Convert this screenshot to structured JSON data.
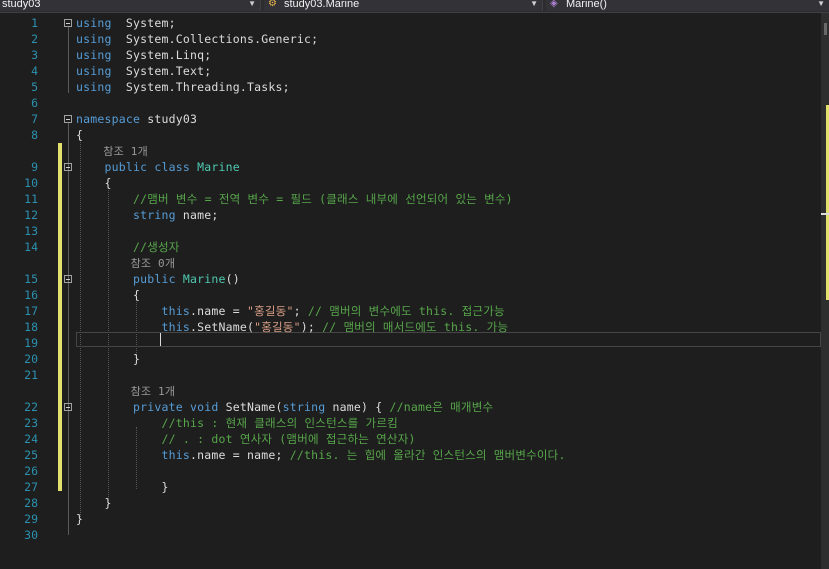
{
  "navbar": {
    "project": "study03",
    "class": "study03.Marine",
    "member": "Marine()",
    "class_icon": "class-icon",
    "member_icon": "method-icon"
  },
  "editor": {
    "lines": [
      {
        "n": "1",
        "t": [
          [
            "kw",
            "using"
          ],
          [
            "",
            "  System;"
          ]
        ]
      },
      {
        "n": "2",
        "t": [
          [
            "kw",
            "using"
          ],
          [
            "",
            "  System.Collections.Generic;"
          ]
        ]
      },
      {
        "n": "3",
        "t": [
          [
            "kw",
            "using"
          ],
          [
            "",
            "  System.Linq;"
          ]
        ]
      },
      {
        "n": "4",
        "t": [
          [
            "kw",
            "using"
          ],
          [
            "",
            "  System.Text;"
          ]
        ]
      },
      {
        "n": "5",
        "t": [
          [
            "kw",
            "using"
          ],
          [
            "",
            "  System.Threading.Tasks;"
          ]
        ]
      },
      {
        "n": "6",
        "t": []
      },
      {
        "n": "7",
        "t": [
          [
            "kw",
            "namespace"
          ],
          [
            "",
            " study03"
          ]
        ]
      },
      {
        "n": "8",
        "t": [
          [
            "",
            "{"
          ]
        ]
      },
      {
        "n": "",
        "t": [
          [
            "codelens",
            "    참조 1개"
          ]
        ]
      },
      {
        "n": "9",
        "t": [
          [
            "kw",
            "    public class "
          ],
          [
            "ty",
            "Marine"
          ]
        ]
      },
      {
        "n": "10",
        "t": [
          [
            "",
            "    {"
          ]
        ]
      },
      {
        "n": "11",
        "t": [
          [
            "cm",
            "        //맴버 변수 = 전역 변수 = 필드 (클래스 내부에 선언되어 있는 변수)"
          ]
        ]
      },
      {
        "n": "12",
        "t": [
          [
            "kw",
            "        string"
          ],
          [
            "",
            " name;"
          ]
        ]
      },
      {
        "n": "13",
        "t": []
      },
      {
        "n": "14",
        "t": [
          [
            "cm",
            "        //생성자"
          ]
        ]
      },
      {
        "n": "",
        "t": [
          [
            "codelens",
            "        참조 0개"
          ]
        ]
      },
      {
        "n": "15",
        "t": [
          [
            "kw",
            "        public "
          ],
          [
            "ty",
            "Marine"
          ],
          [
            "",
            "()"
          ]
        ]
      },
      {
        "n": "16",
        "t": [
          [
            "",
            "        {"
          ]
        ]
      },
      {
        "n": "17",
        "t": [
          [
            "kw",
            "            this"
          ],
          [
            "",
            ".name = "
          ],
          [
            "str",
            "\"홍길동\""
          ],
          [
            "",
            "; "
          ],
          [
            "cm",
            "// 맴버의 변수에도 this. 접근가능"
          ]
        ]
      },
      {
        "n": "18",
        "t": [
          [
            "kw",
            "            this"
          ],
          [
            "",
            ".SetName("
          ],
          [
            "str",
            "\"홍길동\""
          ],
          [
            "",
            "); "
          ],
          [
            "cm",
            "// 맴버의 매서드에도 this. 가능"
          ]
        ]
      },
      {
        "n": "19",
        "t": []
      },
      {
        "n": "20",
        "t": [
          [
            "",
            "        }"
          ]
        ]
      },
      {
        "n": "21",
        "t": []
      },
      {
        "n": "",
        "t": [
          [
            "codelens",
            "        참조 1개"
          ]
        ]
      },
      {
        "n": "22",
        "t": [
          [
            "kw",
            "        private void "
          ],
          [
            "",
            "SetName("
          ],
          [
            "kw",
            "string"
          ],
          [
            "",
            " name) { "
          ],
          [
            "cm",
            "//name은 매개변수"
          ]
        ]
      },
      {
        "n": "23",
        "t": [
          [
            "cm",
            "            //this : 현재 클래스의 인스턴스를 가르킴"
          ]
        ]
      },
      {
        "n": "24",
        "t": [
          [
            "cm",
            "            // . : dot 연사자 (맴버에 접근하는 연산자)"
          ]
        ]
      },
      {
        "n": "25",
        "t": [
          [
            "kw",
            "            this"
          ],
          [
            "",
            ".name = name; "
          ],
          [
            "cm",
            "//this. 는 힙에 올라간 인스턴스의 맴버변수이다."
          ]
        ]
      },
      {
        "n": "26",
        "t": []
      },
      {
        "n": "27",
        "t": [
          [
            "",
            "            }"
          ]
        ]
      },
      {
        "n": "28",
        "t": [
          [
            "",
            "    }"
          ]
        ]
      },
      {
        "n": "29",
        "t": [
          [
            "",
            "}"
          ]
        ]
      },
      {
        "n": "30",
        "t": []
      }
    ]
  },
  "colors": {
    "background": "#1e1e1e",
    "line_number": "#2b91af",
    "keyword": "#569cd6",
    "type": "#4ec9b0",
    "string": "#d69d85",
    "comment": "#57a64a",
    "change_marker": "#e1e16c"
  }
}
